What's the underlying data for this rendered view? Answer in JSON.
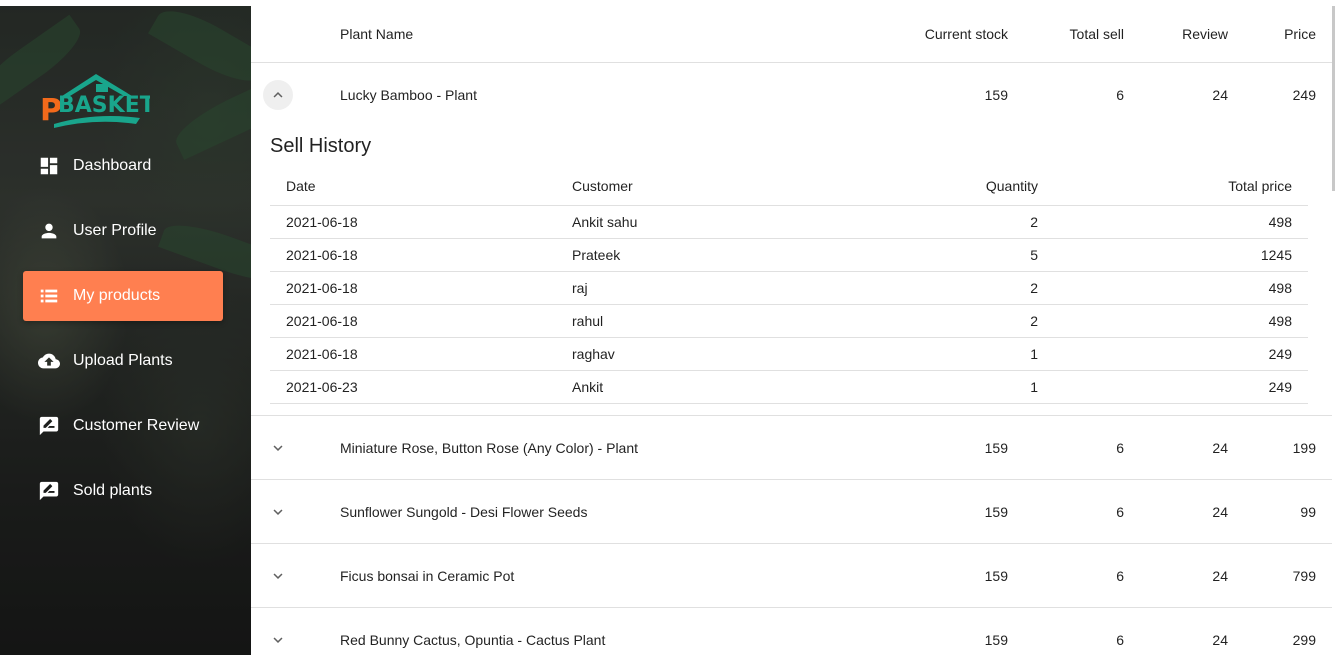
{
  "brand": {
    "logo_text": "BASKET",
    "logo_letter": "P",
    "colors": {
      "logo_orange": "#f26a1b",
      "logo_teal": "#19a58c"
    }
  },
  "sidebar": {
    "items": [
      {
        "label": "Dashboard",
        "icon": "dashboard-icon",
        "active": false
      },
      {
        "label": "User Profile",
        "icon": "person-icon",
        "active": false
      },
      {
        "label": "My products",
        "icon": "list-icon",
        "active": true
      },
      {
        "label": "Upload Plants",
        "icon": "cloud-upload-icon",
        "active": false
      },
      {
        "label": "Customer Review",
        "icon": "rate-review-icon",
        "active": false
      },
      {
        "label": "Sold plants",
        "icon": "rate-review-icon",
        "active": false
      }
    ],
    "active_color": "#ff7f50"
  },
  "table": {
    "headers": {
      "name": "Plant Name",
      "stock": "Current stock",
      "sell": "Total sell",
      "review": "Review",
      "price": "Price"
    },
    "rows": [
      {
        "name": "Lucky Bamboo - Plant",
        "stock": "159",
        "sell": "6",
        "review": "24",
        "price": "249",
        "expanded": true
      },
      {
        "name": "Miniature Rose, Button Rose (Any Color) - Plant",
        "stock": "159",
        "sell": "6",
        "review": "24",
        "price": "199",
        "expanded": false
      },
      {
        "name": "Sunflower Sungold - Desi Flower Seeds",
        "stock": "159",
        "sell": "6",
        "review": "24",
        "price": "99",
        "expanded": false
      },
      {
        "name": "Ficus bonsai in Ceramic Pot",
        "stock": "159",
        "sell": "6",
        "review": "24",
        "price": "799",
        "expanded": false
      },
      {
        "name": "Red Bunny Cactus, Opuntia - Cactus Plant",
        "stock": "159",
        "sell": "6",
        "review": "24",
        "price": "299",
        "expanded": false
      }
    ]
  },
  "sell_history": {
    "title": "Sell History",
    "headers": {
      "date": "Date",
      "customer": "Customer",
      "quantity": "Quantity",
      "total": "Total price"
    },
    "rows": [
      {
        "date": "2021-06-18",
        "customer": "Ankit sahu",
        "quantity": "2",
        "total": "498"
      },
      {
        "date": "2021-06-18",
        "customer": "Prateek",
        "quantity": "5",
        "total": "1245"
      },
      {
        "date": "2021-06-18",
        "customer": "raj",
        "quantity": "2",
        "total": "498"
      },
      {
        "date": "2021-06-18",
        "customer": "rahul",
        "quantity": "2",
        "total": "498"
      },
      {
        "date": "2021-06-18",
        "customer": "raghav",
        "quantity": "1",
        "total": "249"
      },
      {
        "date": "2021-06-23",
        "customer": "Ankit",
        "quantity": "1",
        "total": "249"
      }
    ]
  }
}
